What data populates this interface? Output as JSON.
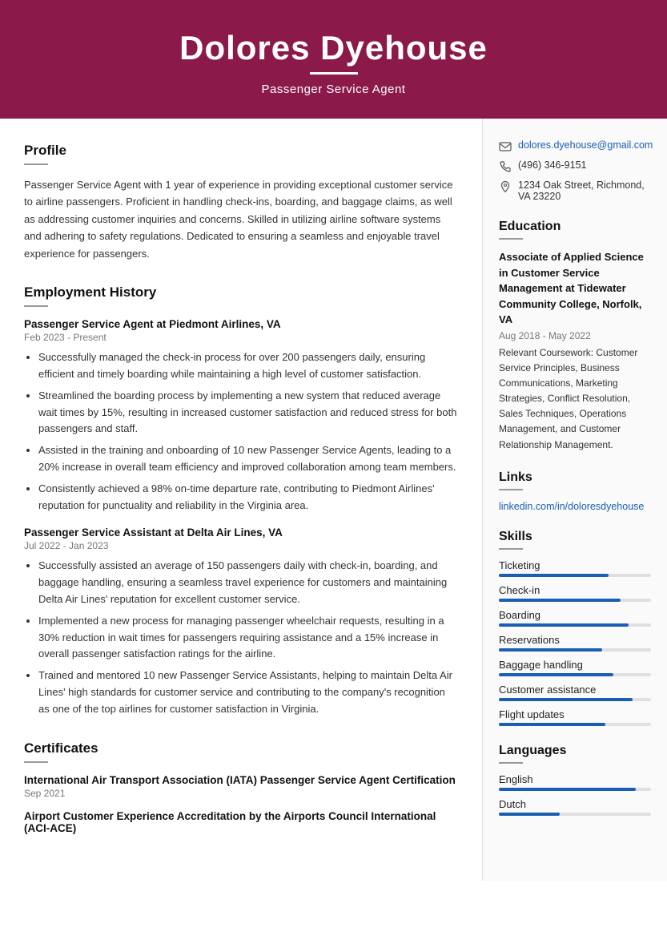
{
  "header": {
    "name": "Dolores Dyehouse",
    "job_title": "Passenger Service Agent"
  },
  "contact": {
    "email": "dolores.dyehouse@gmail.com",
    "phone": "(496) 346-9151",
    "address": "1234 Oak Street, Richmond, VA 23220"
  },
  "profile": {
    "section_title": "Profile",
    "text": "Passenger Service Agent with 1 year of experience in providing exceptional customer service to airline passengers. Proficient in handling check-ins, boarding, and baggage claims, as well as addressing customer inquiries and concerns. Skilled in utilizing airline software systems and adhering to safety regulations. Dedicated to ensuring a seamless and enjoyable travel experience for passengers."
  },
  "employment": {
    "section_title": "Employment History",
    "jobs": [
      {
        "title": "Passenger Service Agent at Piedmont Airlines, VA",
        "dates": "Feb 2023 - Present",
        "bullets": [
          "Successfully managed the check-in process for over 200 passengers daily, ensuring efficient and timely boarding while maintaining a high level of customer satisfaction.",
          "Streamlined the boarding process by implementing a new system that reduced average wait times by 15%, resulting in increased customer satisfaction and reduced stress for both passengers and staff.",
          "Assisted in the training and onboarding of 10 new Passenger Service Agents, leading to a 20% increase in overall team efficiency and improved collaboration among team members.",
          "Consistently achieved a 98% on-time departure rate, contributing to Piedmont Airlines' reputation for punctuality and reliability in the Virginia area."
        ]
      },
      {
        "title": "Passenger Service Assistant at Delta Air Lines, VA",
        "dates": "Jul 2022 - Jan 2023",
        "bullets": [
          "Successfully assisted an average of 150 passengers daily with check-in, boarding, and baggage handling, ensuring a seamless travel experience for customers and maintaining Delta Air Lines' reputation for excellent customer service.",
          "Implemented a new process for managing passenger wheelchair requests, resulting in a 30% reduction in wait times for passengers requiring assistance and a 15% increase in overall passenger satisfaction ratings for the airline.",
          "Trained and mentored 10 new Passenger Service Assistants, helping to maintain Delta Air Lines' high standards for customer service and contributing to the company's recognition as one of the top airlines for customer satisfaction in Virginia."
        ]
      }
    ]
  },
  "certificates": {
    "section_title": "Certificates",
    "items": [
      {
        "title": "International Air Transport Association (IATA) Passenger Service Agent Certification",
        "date": "Sep 2021"
      },
      {
        "title": "Airport Customer Experience Accreditation by the Airports Council International (ACI-ACE)",
        "date": ""
      }
    ]
  },
  "education": {
    "section_title": "Education",
    "degree": "Associate of Applied Science in Customer Service Management at Tidewater Community College, Norfolk, VA",
    "dates": "Aug 2018 - May 2022",
    "courses": "Relevant Coursework: Customer Service Principles, Business Communications, Marketing Strategies, Conflict Resolution, Sales Techniques, Operations Management, and Customer Relationship Management."
  },
  "links": {
    "section_title": "Links",
    "items": [
      {
        "label": "linkedin.com/in/doloresdyehouse",
        "url": "#"
      }
    ]
  },
  "skills": {
    "section_title": "Skills",
    "items": [
      {
        "label": "Ticketing",
        "percent": 72
      },
      {
        "label": "Check-in",
        "percent": 80
      },
      {
        "label": "Boarding",
        "percent": 85
      },
      {
        "label": "Reservations",
        "percent": 68
      },
      {
        "label": "Baggage handling",
        "percent": 75
      },
      {
        "label": "Customer assistance",
        "percent": 88
      },
      {
        "label": "Flight updates",
        "percent": 70
      }
    ]
  },
  "languages": {
    "section_title": "Languages",
    "items": [
      {
        "label": "English",
        "percent": 90
      },
      {
        "label": "Dutch",
        "percent": 40
      }
    ]
  }
}
